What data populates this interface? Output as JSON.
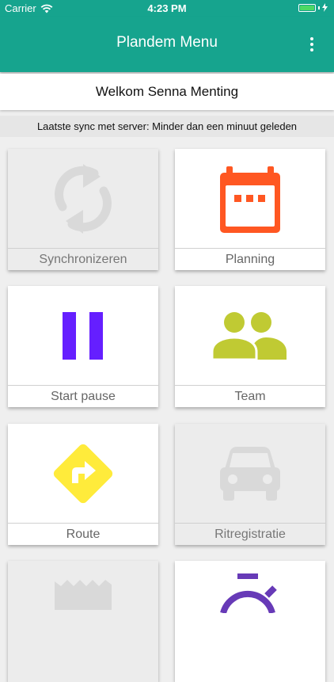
{
  "status_bar": {
    "carrier": "Carrier",
    "time": "4:23 PM"
  },
  "app_bar": {
    "title": "Plandem Menu"
  },
  "welcome": "Welkom Senna Menting",
  "sync_status": "Laatste sync met server: Minder dan een minuut geleden",
  "tiles": [
    {
      "label": "Synchronizeren",
      "icon": "sync-icon",
      "enabled": false
    },
    {
      "label": "Planning",
      "icon": "calendar-icon",
      "enabled": true,
      "color": "#ff5722"
    },
    {
      "label": "Start pause",
      "icon": "pause-icon",
      "enabled": true,
      "color": "#651fff"
    },
    {
      "label": "Team",
      "icon": "people-icon",
      "enabled": true,
      "color": "#c0ca33"
    },
    {
      "label": "Route",
      "icon": "route-sign-icon",
      "enabled": true,
      "color": "#ffeb3b"
    },
    {
      "label": "Ritregistratie",
      "icon": "car-icon",
      "enabled": false
    },
    {
      "label": "",
      "icon": "receipt-icon",
      "enabled": false
    },
    {
      "label": "",
      "icon": "timer-icon",
      "enabled": true,
      "color": "#673ab7"
    }
  ],
  "colors": {
    "primary": "#16a48e",
    "disabled_icon": "#d9d9d9"
  }
}
